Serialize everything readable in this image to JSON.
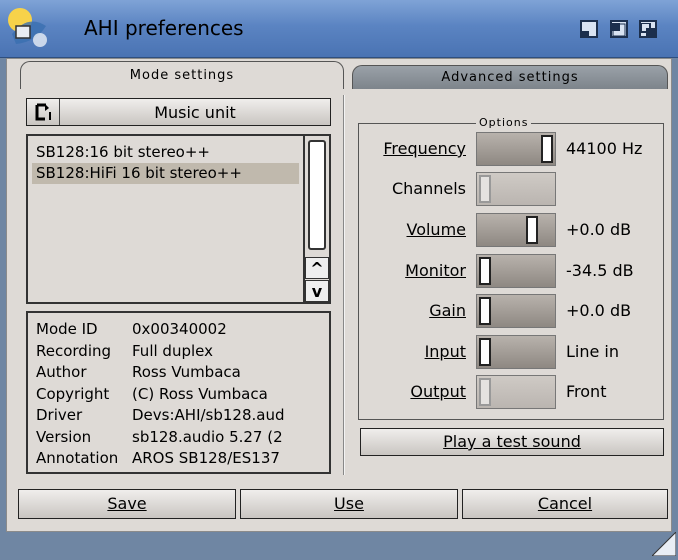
{
  "window": {
    "title": "AHI preferences"
  },
  "tabs": [
    {
      "label": "Mode settings",
      "active": true
    },
    {
      "label": "Advanced settings",
      "active": false
    }
  ],
  "unit_cycle": {
    "label": "Music unit"
  },
  "modes": [
    {
      "label": "SB128:16 bit stereo++",
      "selected": false
    },
    {
      "label": "SB128:HiFi 16 bit stereo++",
      "selected": true
    }
  ],
  "mode_info": [
    {
      "key": "Mode ID",
      "value": "0x00340002"
    },
    {
      "key": "Recording",
      "value": "Full duplex"
    },
    {
      "key": "Author",
      "value": "Ross Vumbaca"
    },
    {
      "key": "Copyright",
      "value": "(C) Ross Vumbaca"
    },
    {
      "key": "Driver",
      "value": "Devs:AHI/sb128.aud"
    },
    {
      "key": "Version",
      "value": "sb128.audio 5.27 (2"
    },
    {
      "key": "Annotation",
      "value": "AROS SB128/ES137"
    }
  ],
  "options": {
    "title": "Options",
    "frequency": {
      "label": "Frequency",
      "value": "44100 Hz",
      "level": 1.0
    },
    "channels": {
      "label": "Channels",
      "value": "",
      "level": 0.0
    },
    "volume": {
      "label": "Volume",
      "value": "+0.0 dB",
      "level": 0.75
    },
    "monitor": {
      "label": "Monitor",
      "value": "-34.5 dB",
      "level": 0.0
    },
    "gain": {
      "label": "Gain",
      "value": "+0.0 dB",
      "level": 0.0
    },
    "input": {
      "label": "Input",
      "value": "Line in",
      "level": 0.0
    },
    "output": {
      "label": "Output",
      "value": "Front",
      "level": 0.0
    }
  },
  "play_button": "Play a test sound",
  "buttons": {
    "save": "Save",
    "use": "Use",
    "cancel": "Cancel"
  },
  "scroll_arrows": {
    "up": "^",
    "down": "v"
  },
  "icons": [
    "app-icon",
    "iconify-icon",
    "zoom-icon",
    "depth-icon",
    "cycle-icon",
    "resize-grip-icon"
  ]
}
